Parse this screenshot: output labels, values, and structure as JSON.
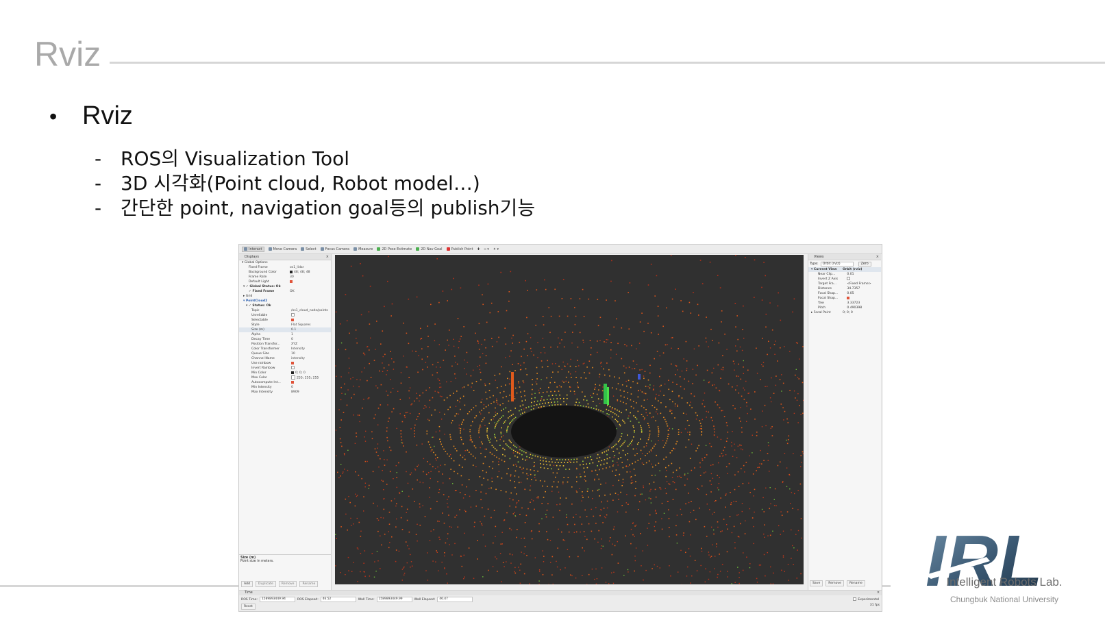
{
  "slide": {
    "title": "Rviz",
    "bullet_glyph": "•",
    "bullet": "Rviz",
    "dash": "-",
    "subitems": [
      "ROS의 Visualization Tool",
      "3D 시각화(Point cloud, Robot model…)",
      "간단한 point, navigation goal등의 publish기능"
    ]
  },
  "rviz": {
    "toolbar": [
      "Interact",
      "Move Camera",
      "Select",
      "Focus Camera",
      "Measure",
      "2D Pose Estimate",
      "2D Nav Goal",
      "Publish Point"
    ],
    "displays": {
      "title": "Displays",
      "close": "×",
      "rows": [
        {
          "k": "▾ Global Options",
          "v": ""
        },
        {
          "k": "Fixed Frame",
          "v": "os1_lidar"
        },
        {
          "k": "Background Color",
          "v": "48; 48; 48"
        },
        {
          "k": "Frame Rate",
          "v": "30"
        },
        {
          "k": "Default Light",
          "v": ""
        },
        {
          "k": "▾ ✓ Global Status: Ok",
          "v": ""
        },
        {
          "k": "✓ Fixed Frame",
          "v": "OK"
        },
        {
          "k": "▸ Grid",
          "v": ""
        },
        {
          "k": "▾ PointCloud2",
          "v": ""
        },
        {
          "k": "▾ ✓ Status: Ok",
          "v": ""
        },
        {
          "k": "Topic",
          "v": "/os1_cloud_node/points"
        },
        {
          "k": "Unreliable",
          "v": ""
        },
        {
          "k": "Selectable",
          "v": ""
        },
        {
          "k": "Style",
          "v": "Flat Squares"
        },
        {
          "k": "Size (m)",
          "v": "0.1"
        },
        {
          "k": "Alpha",
          "v": "1"
        },
        {
          "k": "Decay Time",
          "v": "0"
        },
        {
          "k": "Position Transfor...",
          "v": "XYZ"
        },
        {
          "k": "Color Transformer",
          "v": "Intensity"
        },
        {
          "k": "Queue Size",
          "v": "10"
        },
        {
          "k": "Channel Name",
          "v": "intensity"
        },
        {
          "k": "Use rainbow",
          "v": ""
        },
        {
          "k": "Invert Rainbow",
          "v": ""
        },
        {
          "k": "Min Color",
          "v": "0; 0; 0"
        },
        {
          "k": "Max Color",
          "v": "255; 255; 255"
        },
        {
          "k": "Autocompute Int...",
          "v": ""
        },
        {
          "k": "Min Intensity",
          "v": "0"
        },
        {
          "k": "Max Intensity",
          "v": "8909"
        }
      ],
      "help_title": "Size (m)",
      "help_text": "Point size in meters.",
      "buttons": [
        "Add",
        "Duplicate",
        "Remove",
        "Rename"
      ]
    },
    "views": {
      "title": "Views",
      "close": "×",
      "type_label": "Type:",
      "type_value": "Orbit (rviz)",
      "zero": "Zero",
      "rows": [
        {
          "k": "▾ Current View",
          "v": "Orbit (rviz)"
        },
        {
          "k": "Near Clip...",
          "v": "0.01"
        },
        {
          "k": "Invert Z Axis",
          "v": ""
        },
        {
          "k": "Target Fra...",
          "v": "<Fixed Frame>"
        },
        {
          "k": "Distance",
          "v": "34.7357"
        },
        {
          "k": "Focal Shap...",
          "v": "0.05"
        },
        {
          "k": "Focal Shap...",
          "v": ""
        },
        {
          "k": "Yaw",
          "v": "3.33723"
        },
        {
          "k": "Pitch",
          "v": "0.490398"
        },
        {
          "k": "▸ Focal Point",
          "v": "0; 0; 0"
        }
      ],
      "buttons": [
        "Save",
        "Remove",
        "Rename"
      ]
    },
    "time": {
      "title": "Time",
      "close": "×",
      "ros_time_label": "ROS Time:",
      "ros_time": "1589893449.94",
      "ros_elapsed_label": "ROS Elapsed:",
      "ros_elapsed": "46.52",
      "wall_time_label": "Wall Time:",
      "wall_time": "1589893449.99",
      "wall_elapsed_label": "Wall Elapsed:",
      "wall_elapsed": "46.47",
      "experimental": "Experimental",
      "reset": "Reset",
      "fps": "31 fps"
    },
    "viewport_background": "#303030"
  },
  "logo": {
    "text": "IRL",
    "line1": "Intelligent Robots Lab.",
    "line2": "Chungbuk National University"
  }
}
